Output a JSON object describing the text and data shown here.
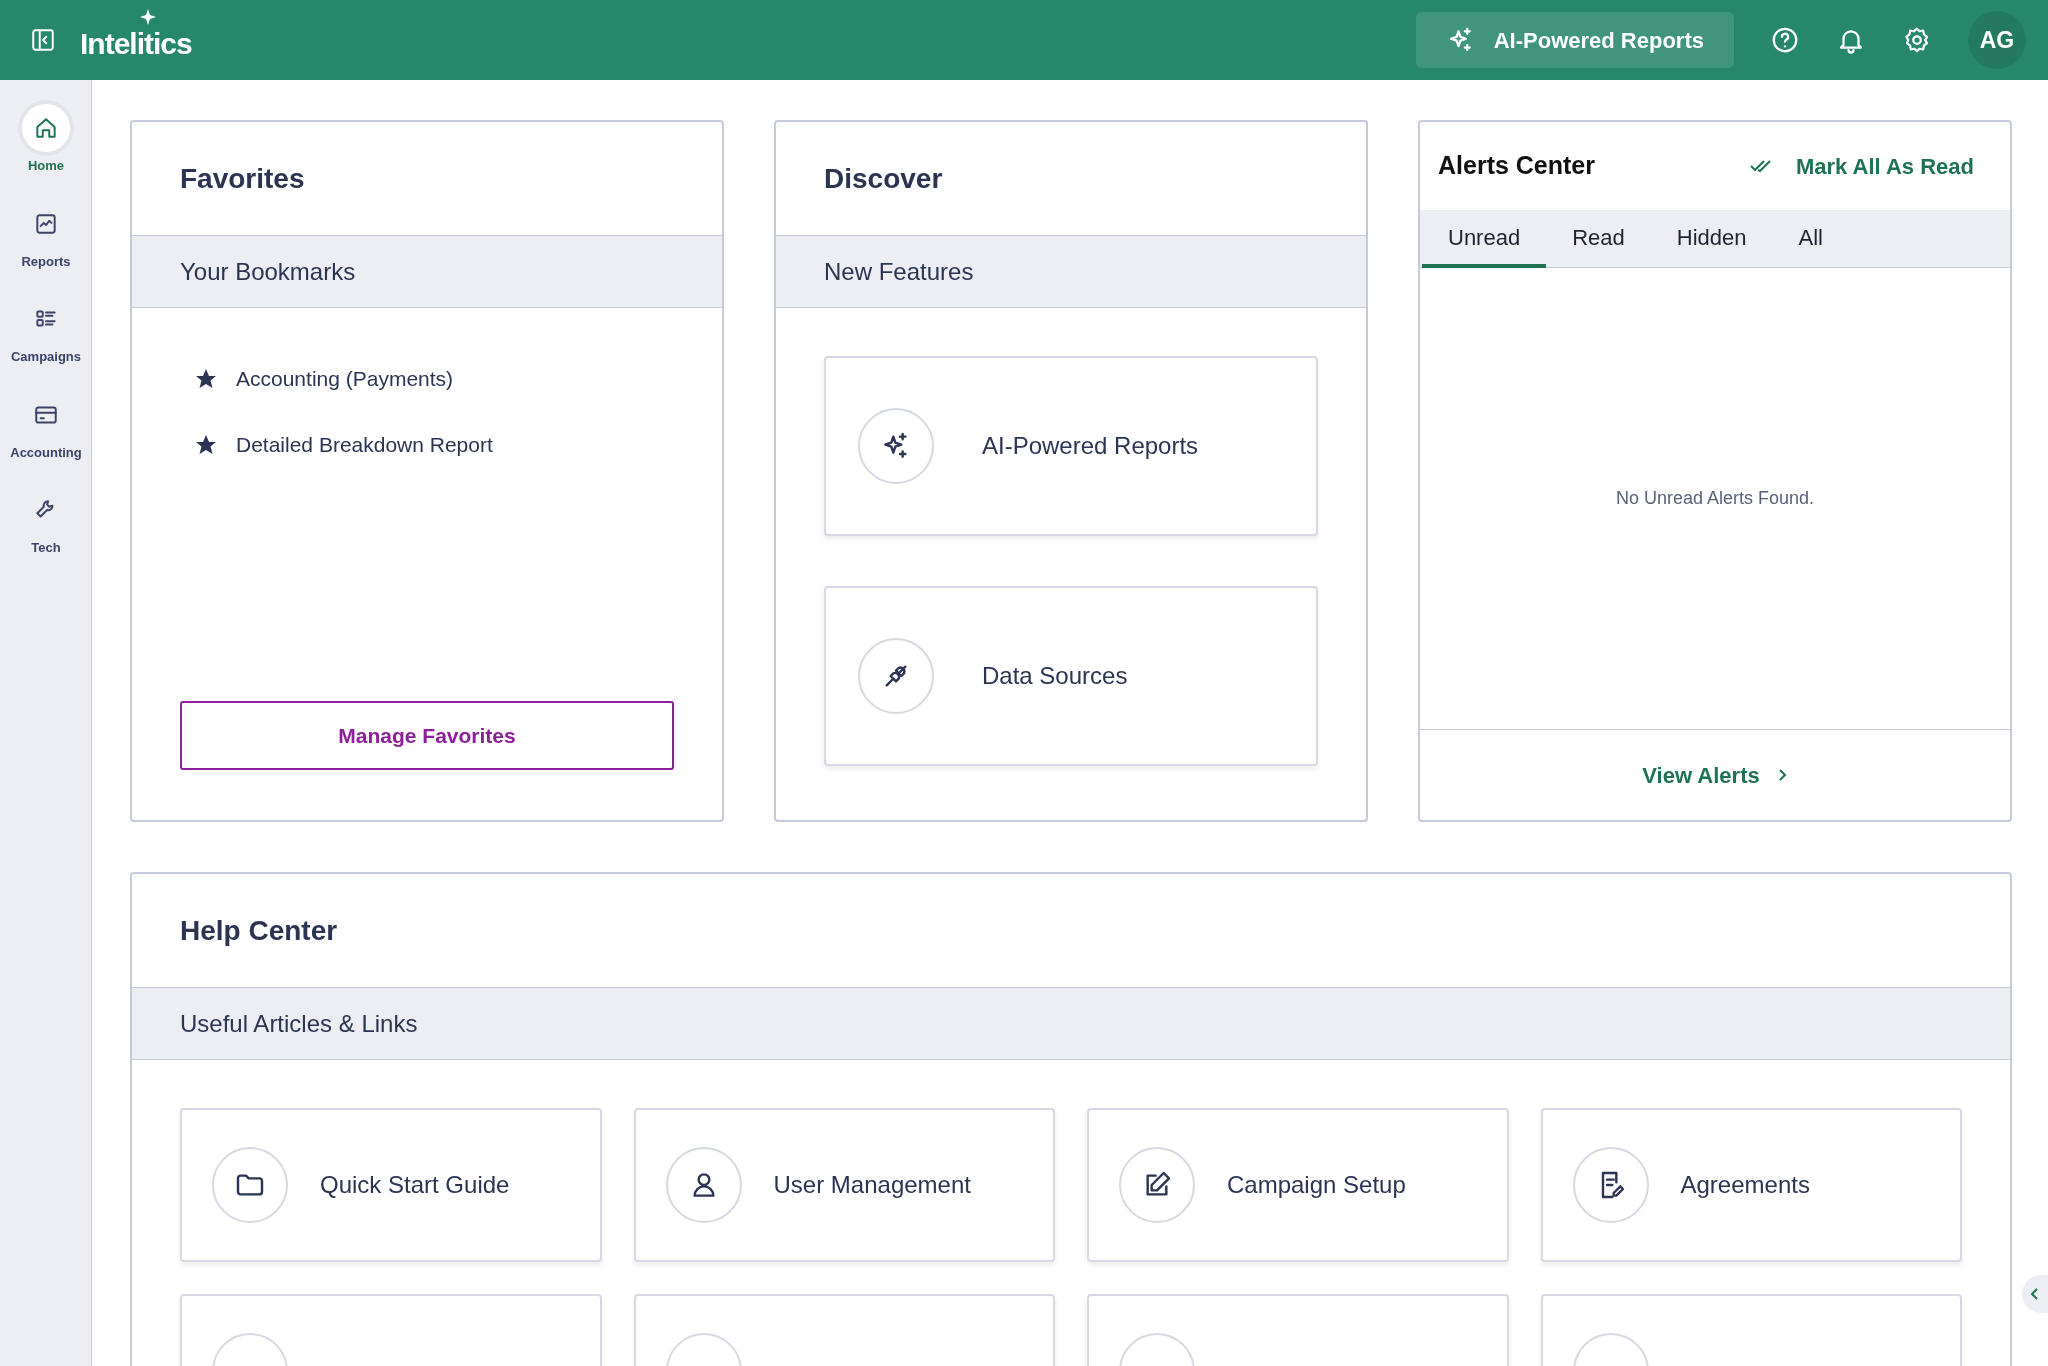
{
  "header": {
    "brand": "Intelitics",
    "ai_button": "AI-Powered Reports",
    "avatar": "AG"
  },
  "sidebar": {
    "items": [
      {
        "label": "Home",
        "selected": true
      },
      {
        "label": "Reports",
        "selected": false
      },
      {
        "label": "Campaigns",
        "selected": false
      },
      {
        "label": "Accounting",
        "selected": false
      },
      {
        "label": "Tech",
        "selected": false
      }
    ]
  },
  "favorites": {
    "title": "Favorites",
    "subtitle": "Your Bookmarks",
    "bookmarks": [
      "Accounting (Payments)",
      "Detailed Breakdown Report"
    ],
    "button": "Manage Favorites"
  },
  "discover": {
    "title": "Discover",
    "subtitle": "New Features",
    "features": [
      "AI-Powered Reports",
      "Data Sources"
    ]
  },
  "alerts": {
    "title": "Alerts Center",
    "mark_all": "Mark All As Read",
    "tabs": [
      {
        "label": "Unread",
        "selected": true
      },
      {
        "label": "Read",
        "selected": false
      },
      {
        "label": "Hidden",
        "selected": false
      },
      {
        "label": "All",
        "selected": false
      }
    ],
    "empty": "No Unread Alerts Found.",
    "view": "View Alerts"
  },
  "help": {
    "title": "Help Center",
    "subtitle": "Useful Articles & Links",
    "links": [
      {
        "kind": "full",
        "label": "Quick Start Guide"
      },
      {
        "kind": "full",
        "label": "User Management"
      },
      {
        "kind": "full",
        "label": "Campaign Setup"
      },
      {
        "kind": "full",
        "label": "Agreements"
      },
      {
        "kind": "cut"
      },
      {
        "kind": "cut"
      },
      {
        "kind": "cut"
      },
      {
        "kind": "cut"
      }
    ]
  }
}
